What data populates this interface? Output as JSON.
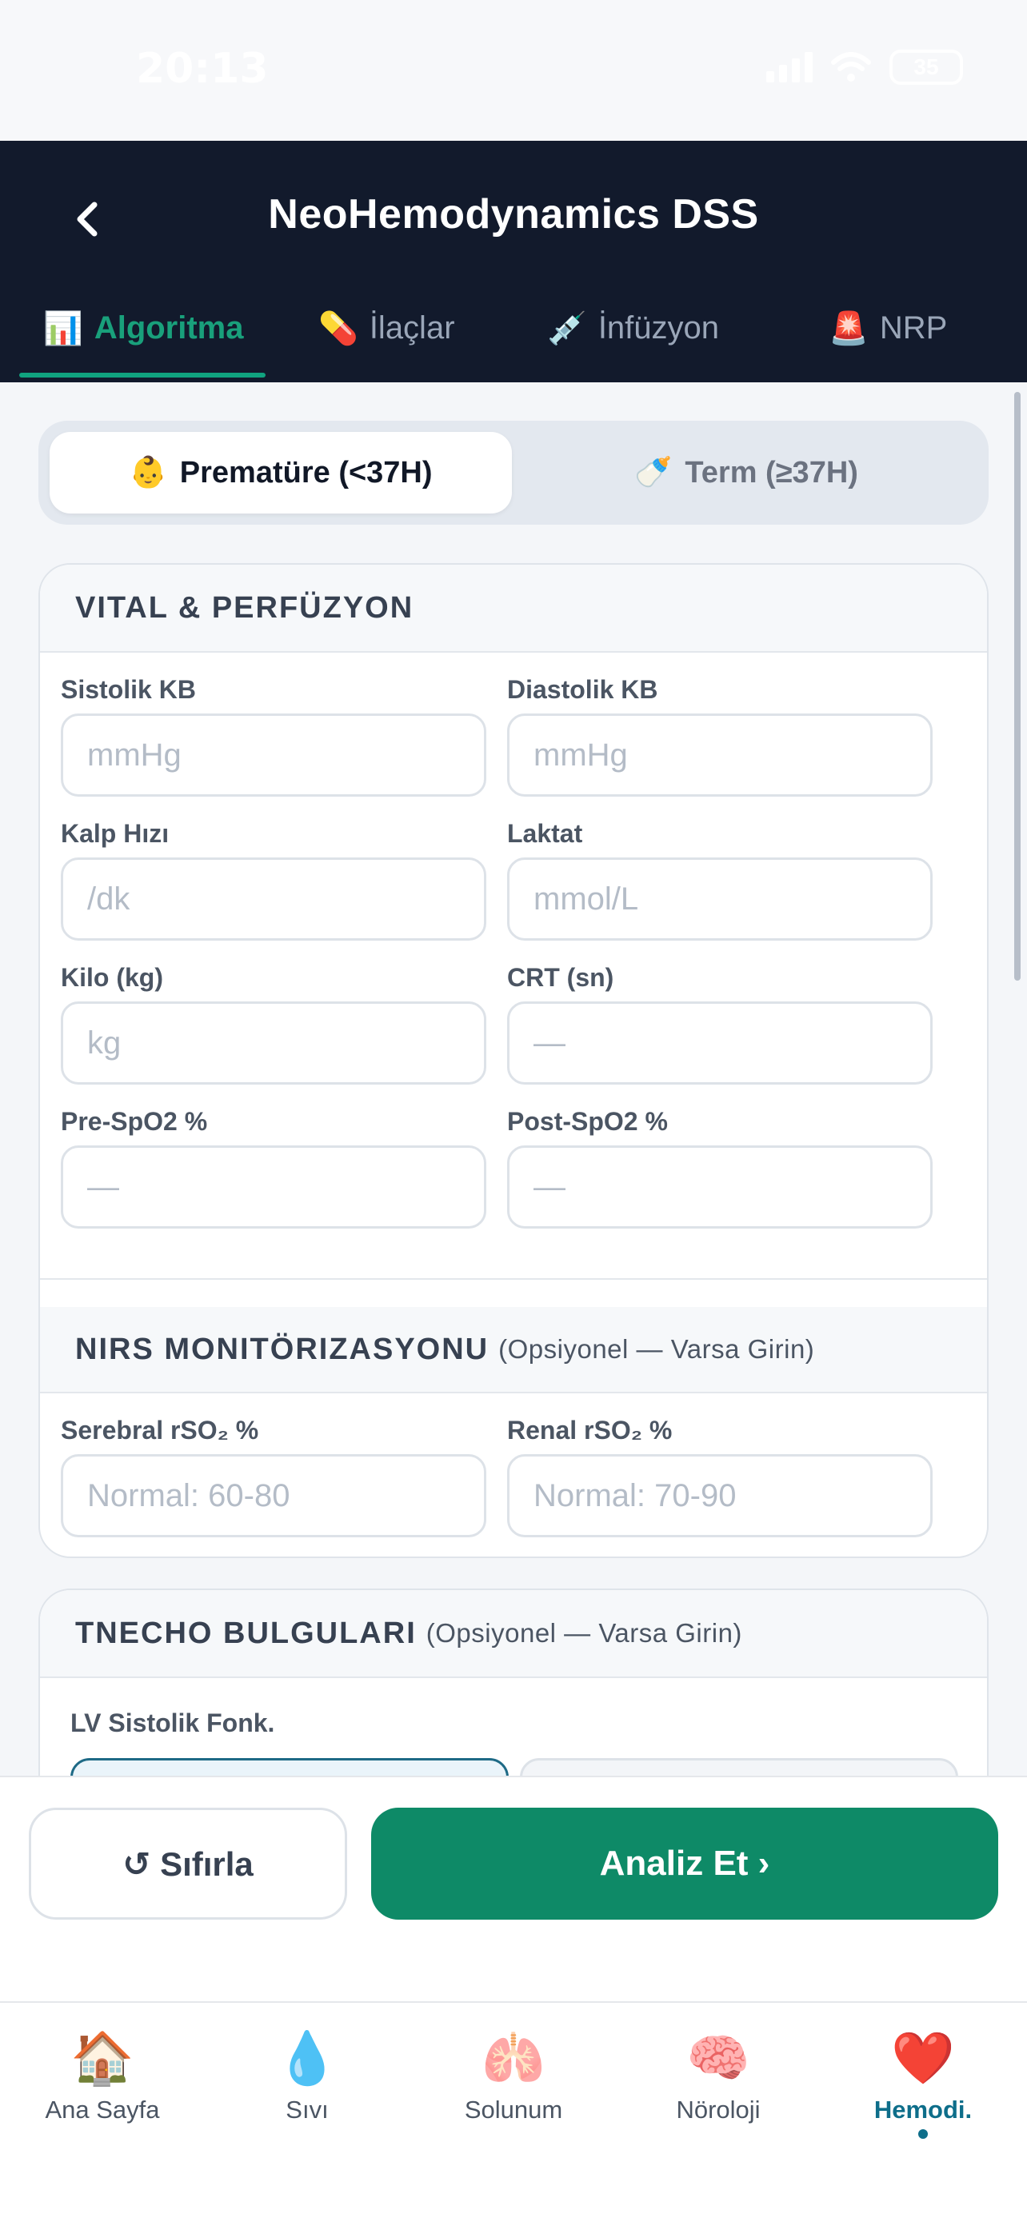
{
  "status_bar": {
    "time": "20:13",
    "battery": "35"
  },
  "header": {
    "title": "NeoHemodynamics DSS"
  },
  "tabs": [
    {
      "icon": "📊",
      "label": "Algoritma",
      "active": true
    },
    {
      "icon": "💊",
      "label": "İlaçlar"
    },
    {
      "icon": "💉",
      "label": "İnfüzyon"
    },
    {
      "icon": "🚨",
      "label": "NRP"
    }
  ],
  "segment": {
    "preterm": {
      "icon": "👶",
      "label": "Prematüre (<37H)"
    },
    "term": {
      "icon": "🍼",
      "label": "Term (≥37H)"
    }
  },
  "vital": {
    "title": "VITAL & PERFÜZYON",
    "fields": [
      {
        "label": "Sistolik KB",
        "placeholder": "mmHg"
      },
      {
        "label": "Diastolik KB",
        "placeholder": "mmHg"
      },
      {
        "label": "Kalp Hızı",
        "placeholder": "/dk"
      },
      {
        "label": "Laktat",
        "placeholder": "mmol/L"
      },
      {
        "label": "Kilo (kg)",
        "placeholder": "kg"
      },
      {
        "label": "CRT (sn)",
        "placeholder": "—"
      },
      {
        "label": "Pre-SpO2 %",
        "placeholder": "—"
      },
      {
        "label": "Post-SpO2 %",
        "placeholder": "—"
      }
    ]
  },
  "nirs": {
    "title": "NIRS MONITÖRIZASYONU",
    "subtitle": "(Opsiyonel — Varsa Girin)",
    "fields": [
      {
        "label": "Serebral rSO₂ %",
        "placeholder": "Normal: 60-80"
      },
      {
        "label": "Renal rSO₂ %",
        "placeholder": "Normal: 70-90"
      }
    ]
  },
  "echo": {
    "title": "TNECHO BULGULARI",
    "subtitle": "(Opsiyonel — Varsa Girin)",
    "lv_label": "LV Sistolik Fonk."
  },
  "actions": {
    "reset": "↺ Sıfırla",
    "analyze": "Analiz Et ›"
  },
  "bottom_nav": [
    {
      "icon": "🏠",
      "label": "Ana Sayfa"
    },
    {
      "icon": "💧",
      "label": "Sıvı"
    },
    {
      "icon": "🫁",
      "label": "Solunum"
    },
    {
      "icon": "🧠",
      "label": "Nöroloji"
    },
    {
      "icon": "❤️",
      "label": "Hemodi.",
      "active": true
    }
  ]
}
